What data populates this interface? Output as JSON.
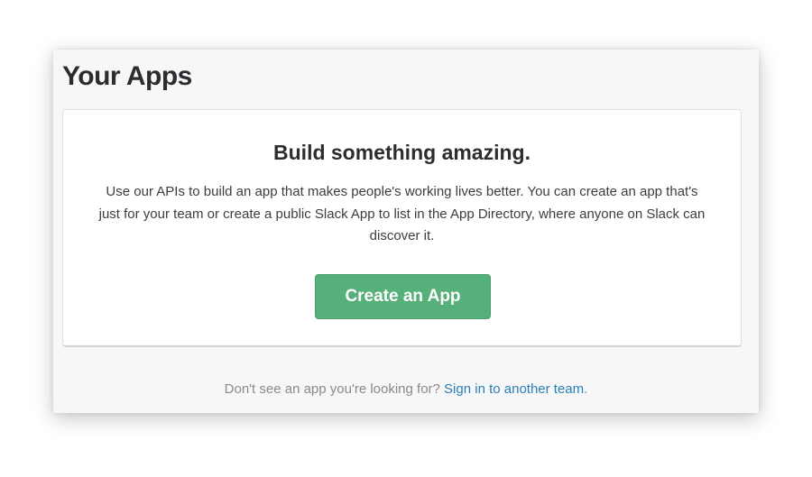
{
  "page": {
    "title": "Your Apps"
  },
  "card": {
    "heading": "Build something amazing.",
    "description": "Use our APIs to build an app that makes people's working lives better. You can create an app that's just for your team or create a public Slack App to list in the App Directory, where anyone on Slack can discover it.",
    "button_label": "Create an App"
  },
  "footer": {
    "prompt": "Don't see an app you're looking for? ",
    "link_label": "Sign in to another team",
    "suffix": "."
  },
  "colors": {
    "button_green": "#56b07a",
    "link_blue": "#2a80b9",
    "panel_bg": "#f7f7f7"
  }
}
